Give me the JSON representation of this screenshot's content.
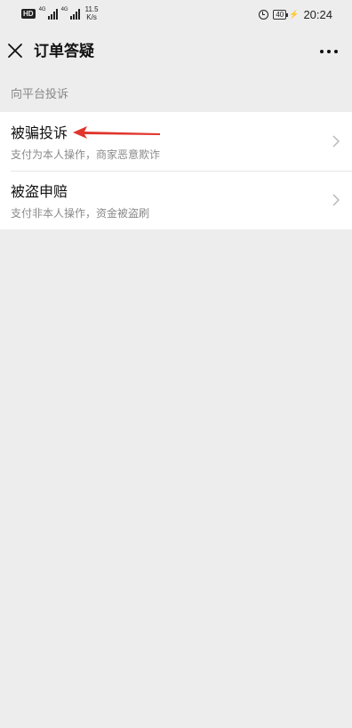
{
  "status_bar": {
    "hd": "HD",
    "sim1_tag": "4G",
    "sim2_tag": "4G",
    "net_speed_value": "11.5",
    "net_speed_unit": "K/s",
    "battery": "40",
    "time": "20:24"
  },
  "nav": {
    "title": "订单答疑",
    "close_icon": "close-icon",
    "more_icon": "more-icon"
  },
  "section": {
    "title": "向平台投诉"
  },
  "items": [
    {
      "title": "被骗投诉",
      "subtitle": "支付为本人操作，商家恶意欺诈"
    },
    {
      "title": "被盗申赔",
      "subtitle": "支付非本人操作，资金被盗刷"
    }
  ],
  "colors": {
    "background": "#ededed",
    "card": "#ffffff",
    "annotation_arrow": "#e0342c",
    "secondary_text": "#8a8a8a"
  }
}
